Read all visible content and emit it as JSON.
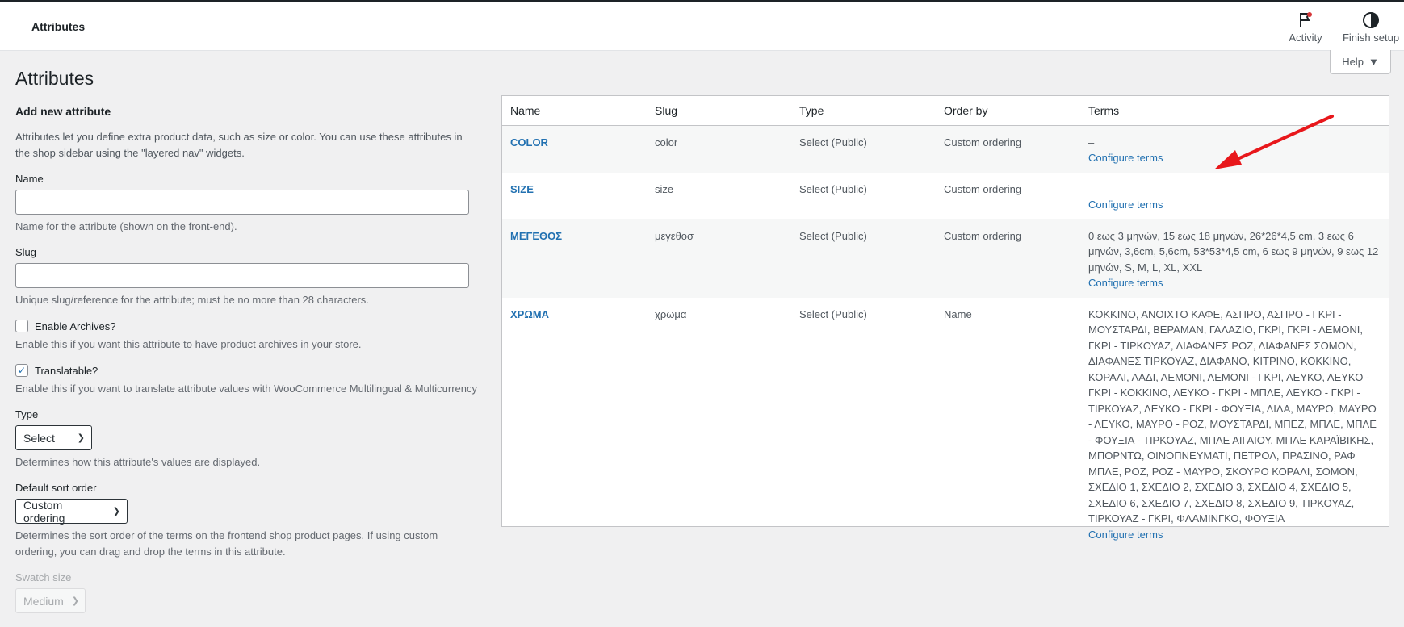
{
  "header": {
    "title": "Attributes",
    "activity_label": "Activity",
    "finish_setup_label": "Finish setup"
  },
  "help_button": {
    "label": "Help"
  },
  "page": {
    "title": "Attributes"
  },
  "form": {
    "heading": "Add new attribute",
    "intro": "Attributes let you define extra product data, such as size or color. You can use these attributes in the shop sidebar using the \"layered nav\" widgets.",
    "name_label": "Name",
    "name_value": "",
    "name_help": "Name for the attribute (shown on the front-end).",
    "slug_label": "Slug",
    "slug_value": "",
    "slug_help": "Unique slug/reference for the attribute; must be no more than 28 characters.",
    "archives_label": "Enable Archives?",
    "archives_checked": false,
    "archives_help": "Enable this if you want this attribute to have product archives in your store.",
    "translatable_label": "Translatable?",
    "translatable_checked": true,
    "translatable_help": "Enable this if you want to translate attribute values with WooCommerce Multilingual & Multicurrency",
    "type_label": "Type",
    "type_value": "Select",
    "type_help": "Determines how this attribute's values are displayed.",
    "sort_label": "Default sort order",
    "sort_value": "Custom ordering",
    "sort_help": "Determines the sort order of the terms on the frontend shop product pages. If using custom ordering, you can drag and drop the terms in this attribute.",
    "swatch_label": "Swatch size",
    "swatch_value": "Medium"
  },
  "table": {
    "columns": [
      "Name",
      "Slug",
      "Type",
      "Order by",
      "Terms"
    ],
    "configure_label": "Configure terms",
    "rows": [
      {
        "name": "COLOR",
        "slug": "color",
        "type": "Select (Public)",
        "order_by": "Custom ordering",
        "terms": "–"
      },
      {
        "name": "SIZE",
        "slug": "size",
        "type": "Select (Public)",
        "order_by": "Custom ordering",
        "terms": "–"
      },
      {
        "name": "ΜΕΓΕΘΟΣ",
        "slug": "μεγεθοσ",
        "type": "Select (Public)",
        "order_by": "Custom ordering",
        "terms": "0 εως 3 μηνών, 15 εως 18 μηνών, 26*26*4,5 cm, 3 εως 6 μηνών, 3,6cm, 5,6cm, 53*53*4,5 cm, 6 εως 9 μηνών, 9 εως 12 μηνών, S, M, L, XL, XXL"
      },
      {
        "name": "ΧΡΩΜΑ",
        "slug": "χρωμα",
        "type": "Select (Public)",
        "order_by": "Name",
        "terms": "ΚΟΚΚΙΝΟ, ΑΝΟΙΧΤΟ ΚΑΦΕ, ΑΣΠΡΟ, ΑΣΠΡΟ - ΓΚΡΙ - ΜΟΥΣΤΑΡΔΙ, ΒΕΡΑΜΑΝ, ΓΑΛΑΖΙΟ, ΓΚΡΙ, ΓΚΡΙ - ΛΕΜΟΝΙ, ΓΚΡΙ - ΤΙΡΚΟΥΑΖ, ΔΙΑΦΑΝΕΣ ΡΟΖ, ΔΙΑΦΑΝΕΣ ΣΟΜΟΝ, ΔΙΑΦΑΝΕΣ ΤΙΡΚΟΥΑΖ, ΔΙΑΦΑΝΟ, ΚΙΤΡΙΝΟ, ΚΟΚΚΙΝΟ, ΚΟΡΑΛΙ, ΛΑΔΙ, ΛΕΜΟΝΙ, ΛΕΜΟΝΙ - ΓΚΡΙ, ΛΕΥΚΟ, ΛΕΥΚΟ - ΓΚΡΙ - ΚΟΚΚΙΝΟ, ΛΕΥΚΟ - ΓΚΡΙ - ΜΠΛΕ, ΛΕΥΚΟ - ΓΚΡΙ - ΤΙΡΚΟΥΑΖ, ΛΕΥΚΟ - ΓΚΡΙ - ΦΟΥΞΙΑ, ΛΙΛΑ, ΜΑΥΡΟ, ΜΑΥΡΟ - ΛΕΥΚΟ, ΜΑΥΡΟ - ΡΟΖ, ΜΟΥΣΤΑΡΔΙ, ΜΠΕΖ, ΜΠΛΕ, ΜΠΛΕ - ΦΟΥΞΙΑ - ΤΙΡΚΟΥΑΖ, ΜΠΛΕ ΑΙΓΑΙΟΥ, ΜΠΛΕ ΚΑΡΑΪΒΙΚΗΣ, ΜΠΟΡΝΤΩ, ΟΙΝΟΠΝΕΥΜΑΤΙ, ΠΕΤΡΟΛ, ΠΡΑΣΙΝΟ, ΡΑΦ ΜΠΛΕ, ΡΟΖ, ΡΟΖ - ΜΑΥΡΟ, ΣΚΟΥΡΟ ΚΟΡΑΛΙ, ΣΟΜΟΝ, ΣΧΕΔΙΟ 1, ΣΧΕΔΙΟ 2, ΣΧΕΔΙΟ 3, ΣΧΕΔΙΟ 4, ΣΧΕΔΙΟ 5, ΣΧΕΔΙΟ 6, ΣΧΕΔΙΟ 7, ΣΧΕΔΙΟ 8, ΣΧΕΔΙΟ 9, ΤΙΡΚΟΥΑΖ, ΤΙΡΚΟΥΑΖ - ΓΚΡΙ, ΦΛΑΜΙΝΓΚΟ, ΦΟΥΞΙΑ"
      }
    ]
  },
  "colors": {
    "link": "#2271b1",
    "annotation_arrow": "#e8171b"
  },
  "icons": {
    "activity": "flag-icon",
    "finish_setup": "half-circle-icon",
    "help": "caret-down-icon"
  }
}
